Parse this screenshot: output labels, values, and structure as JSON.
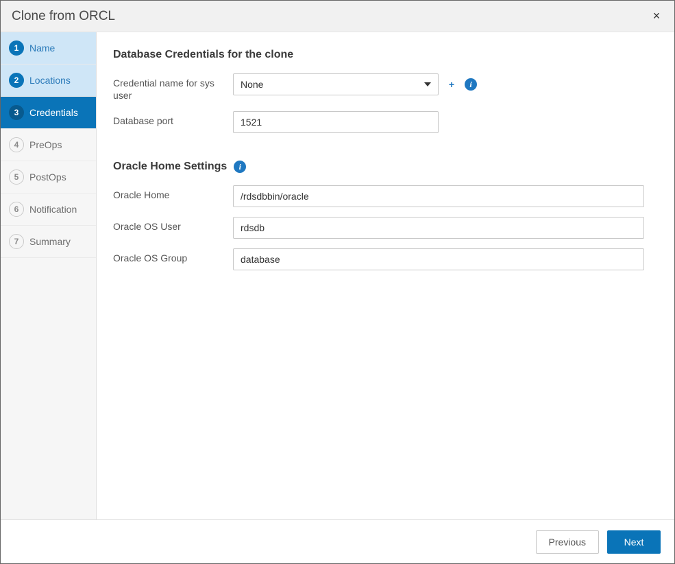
{
  "dialog": {
    "title": "Clone from ORCL",
    "close_symbol": "×"
  },
  "steps": [
    {
      "num": "1",
      "label": "Name",
      "state": "completed"
    },
    {
      "num": "2",
      "label": "Locations",
      "state": "completed"
    },
    {
      "num": "3",
      "label": "Credentials",
      "state": "active"
    },
    {
      "num": "4",
      "label": "PreOps",
      "state": "pending"
    },
    {
      "num": "5",
      "label": "PostOps",
      "state": "pending"
    },
    {
      "num": "6",
      "label": "Notification",
      "state": "pending"
    },
    {
      "num": "7",
      "label": "Summary",
      "state": "pending"
    }
  ],
  "credentials": {
    "title": "Database Credentials for the clone",
    "sys_label": "Credential name for sys user",
    "sys_value": "None",
    "port_label": "Database port",
    "port_value": "1521"
  },
  "oracle": {
    "title": "Oracle Home Settings",
    "home_label": "Oracle Home",
    "home_value": "/rdsdbbin/oracle",
    "osuser_label": "Oracle OS User",
    "osuser_value": "rdsdb",
    "osgroup_label": "Oracle OS Group",
    "osgroup_value": "database"
  },
  "footer": {
    "previous": "Previous",
    "next": "Next"
  },
  "icons": {
    "info_glyph": "i",
    "plus_glyph": "+"
  }
}
